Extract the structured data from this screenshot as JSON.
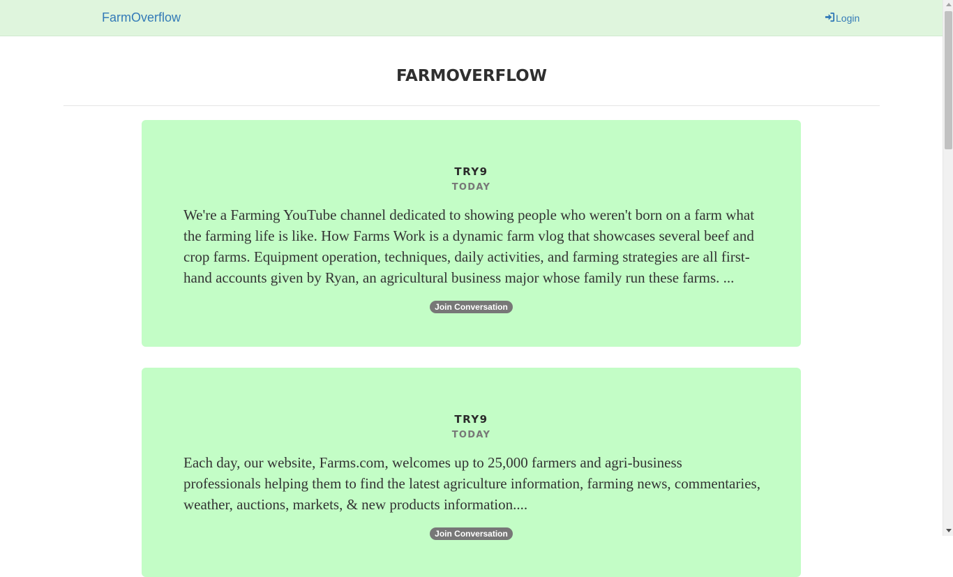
{
  "navbar": {
    "brand": "FarmOverflow",
    "login_label": "Login",
    "login_icon": "sign-in-icon"
  },
  "header": {
    "title": "FarmOverflow"
  },
  "posts": [
    {
      "author": "TRY9",
      "date": "TODAY",
      "body": "We're a Farming YouTube channel dedicated to showing people who weren't born on a farm what the farming life is like. How Farms Work is a dynamic farm vlog that showcases several beef and crop farms. Equipment operation, techniques, daily activities, and farming strategies are all first-hand accounts given by Ryan, an agricultural business major whose family run these farms. ...",
      "button_label": "Join Conversation"
    },
    {
      "author": "TRY9",
      "date": "TODAY",
      "body": "Each day, our website, Farms.com, welcomes up to 25,000 farmers and agri-business professionals helping them to find the latest agriculture information, farming news, commentaries, weather, auctions, markets, & new products information....",
      "button_label": "Join Conversation"
    }
  ],
  "colors": {
    "navbar_bg": "#dff5dd",
    "card_bg": "#c3fdc6",
    "link": "#337ab7",
    "badge": "#777777"
  }
}
